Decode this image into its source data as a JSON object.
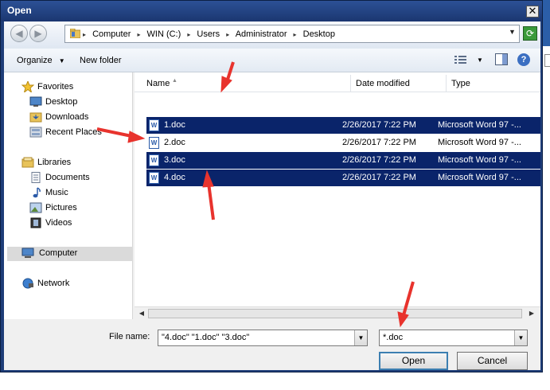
{
  "window": {
    "title": "Open",
    "close_glyph": "✕"
  },
  "address": {
    "crumbs": [
      "Computer",
      "WIN (C:)",
      "Users",
      "Administrator",
      "Desktop"
    ],
    "separator": "▸",
    "dropdown_glyph": "▼"
  },
  "toolbar": {
    "organize_label": "Organize",
    "organize_arrow": "▼",
    "new_folder_label": "New folder",
    "view_arrow": "▼",
    "help_glyph": "?"
  },
  "nav_pane": {
    "favorites": {
      "label": "Favorites",
      "items": [
        "Desktop",
        "Downloads",
        "Recent Places"
      ]
    },
    "libraries": {
      "label": "Libraries",
      "items": [
        "Documents",
        "Music",
        "Pictures",
        "Videos"
      ]
    },
    "computer": "Computer",
    "network": "Network"
  },
  "columns": {
    "name": "Name",
    "date_modified": "Date modified",
    "type": "Type"
  },
  "files": [
    {
      "name": "1.doc",
      "date": "2/26/2017 7:22 PM",
      "type": "Microsoft Word 97 -...",
      "selected": true
    },
    {
      "name": "2.doc",
      "date": "2/26/2017 7:22 PM",
      "type": "Microsoft Word 97 -...",
      "selected": false
    },
    {
      "name": "3.doc",
      "date": "2/26/2017 7:22 PM",
      "type": "Microsoft Word 97 -...",
      "selected": true
    },
    {
      "name": "4.doc",
      "date": "2/26/2017 7:22 PM",
      "type": "Microsoft Word 97 -...",
      "selected": true
    }
  ],
  "file_icon_letter": "W",
  "bottom": {
    "file_name_label": "File name:",
    "file_name_value": "\"4.doc\" \"1.doc\" \"3.doc\"",
    "filter_value": "*.doc",
    "open_label": "Open",
    "cancel_label": "Cancel"
  },
  "colors": {
    "selection": "#0a246a",
    "title_bar": "#1e3d78",
    "annotation_arrow": "#e8332d"
  }
}
